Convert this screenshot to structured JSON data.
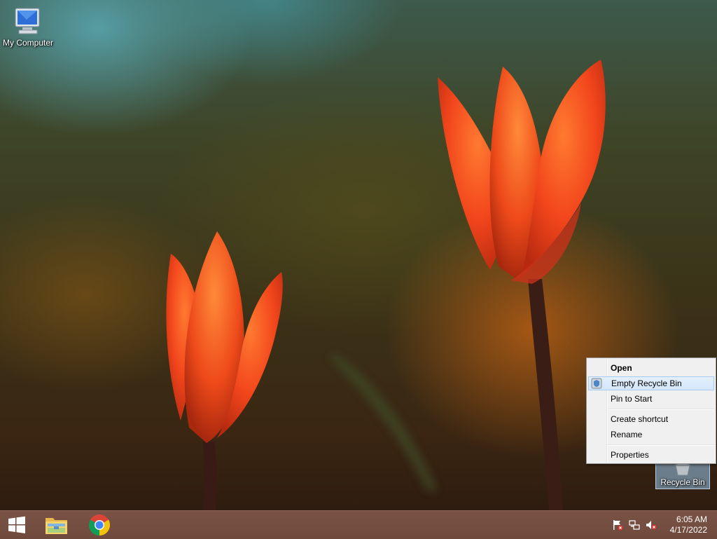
{
  "desktop": {
    "icons": [
      {
        "label": "My Computer",
        "icon": "computer-icon"
      },
      {
        "label": "Recycle Bin",
        "icon": "recycle-bin-icon",
        "selected": true
      }
    ]
  },
  "context_menu": {
    "items": [
      {
        "label": "Open",
        "bold": true
      },
      {
        "label": "Empty Recycle Bin",
        "highlighted": true,
        "icon": "shield-icon"
      },
      {
        "label": "Pin to Start"
      },
      {
        "label": "Create shortcut"
      },
      {
        "label": "Rename"
      },
      {
        "label": "Properties"
      }
    ]
  },
  "taskbar": {
    "pinned": [
      {
        "name": "start",
        "icon": "windows-logo-icon"
      },
      {
        "name": "file-explorer",
        "icon": "folder-icon"
      },
      {
        "name": "chrome",
        "icon": "chrome-icon"
      }
    ],
    "tray": {
      "icons": [
        "action-center-flag-icon",
        "network-icon",
        "volume-muted-icon"
      ],
      "time": "6:05 AM",
      "date": "4/17/2022"
    }
  },
  "colors": {
    "taskbar": "#6e4a3d",
    "menu_bg": "#f0f0f0",
    "menu_highlight": "#d4e6fa",
    "selection": "#99c9ef"
  }
}
